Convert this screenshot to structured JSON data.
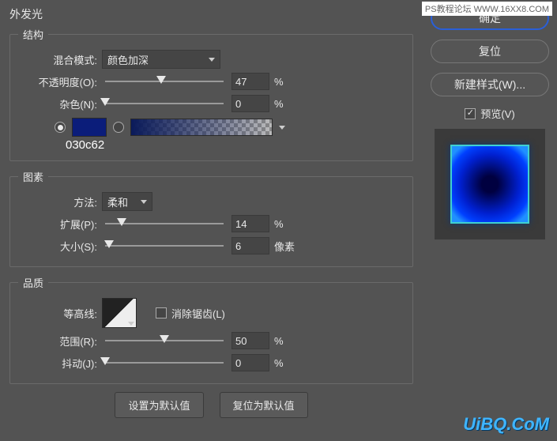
{
  "panel_title": "外发光",
  "structure": {
    "legend": "结构",
    "blend_mode_label": "混合模式:",
    "blend_mode_value": "颜色加深",
    "opacity_label": "不透明度(O):",
    "opacity_value": "47",
    "opacity_unit": "%",
    "noise_label": "杂色(N):",
    "noise_value": "0",
    "noise_unit": "%",
    "color_hex": "030c62",
    "solid_color": "#0b1d7a"
  },
  "elements": {
    "legend": "图素",
    "technique_label": "方法:",
    "technique_value": "柔和",
    "spread_label": "扩展(P):",
    "spread_value": "14",
    "spread_unit": "%",
    "size_label": "大小(S):",
    "size_value": "6",
    "size_unit": "像素"
  },
  "quality": {
    "legend": "品质",
    "contour_label": "等高线:",
    "antialias_label": "消除锯齿(L)",
    "range_label": "范围(R):",
    "range_value": "50",
    "range_unit": "%",
    "jitter_label": "抖动(J):",
    "jitter_value": "0",
    "jitter_unit": "%"
  },
  "footer": {
    "set_default": "设置为默认值",
    "reset_default": "复位为默认值"
  },
  "right": {
    "ok": "确定",
    "reset": "复位",
    "new_style": "新建样式(W)...",
    "preview_label": "预览(V)"
  },
  "watermarks": {
    "top": "PS教程论坛 WWW.16XX8.COM",
    "bottom": "UiBQ.CoM"
  }
}
